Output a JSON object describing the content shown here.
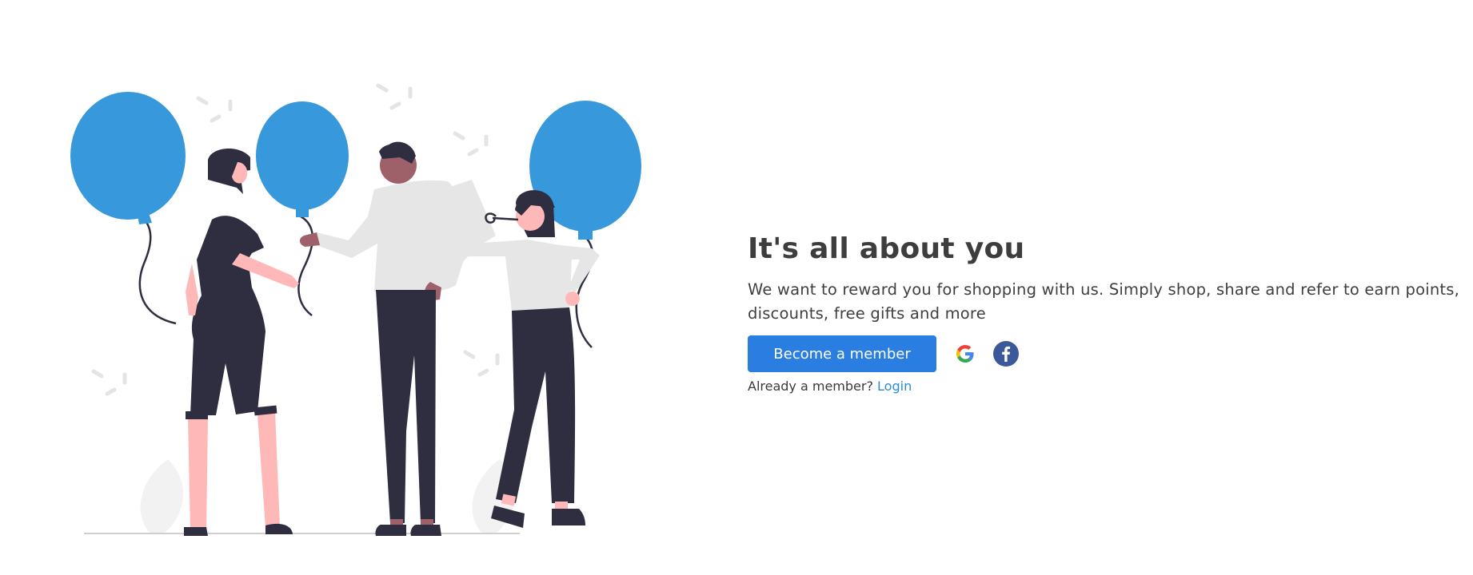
{
  "promo": {
    "heading": "It's all about you",
    "description": "We want to reward you for shopping with us. Simply shop, share and refer to earn points, discounts, free gifts and more",
    "cta_label": "Become a member",
    "social": [
      {
        "icon": "google-icon"
      },
      {
        "icon": "facebook-icon",
        "glyph": "f"
      }
    ],
    "member_prompt": "Already a member?",
    "login_label": "Login"
  },
  "colors": {
    "accent": "#2a7de1",
    "balloon": "#3799db",
    "link": "#2a8ad4",
    "facebook": "#3b5998",
    "text": "#3d3d3d"
  }
}
